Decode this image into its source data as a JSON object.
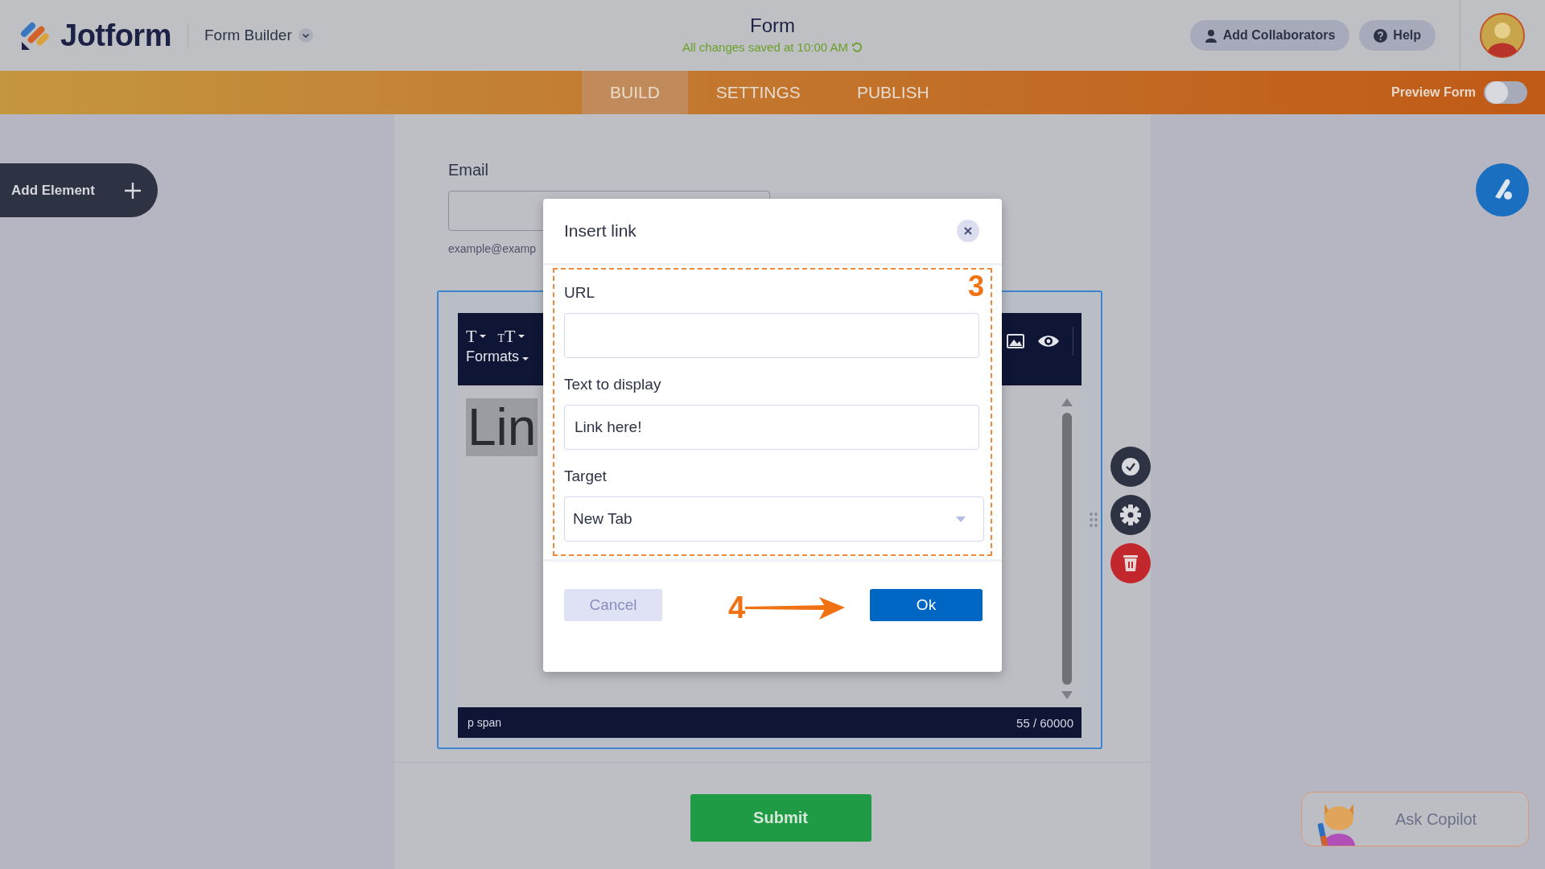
{
  "header": {
    "logo": "Jotform",
    "product_menu": "Form Builder",
    "form_title": "Form",
    "save_status": "All changes saved at 10:00 AM",
    "buttons": [
      {
        "label": "Add Collaborators",
        "kind": "person"
      },
      {
        "label": "Help",
        "kind": "help"
      }
    ]
  },
  "nav": {
    "tabs": [
      {
        "label": "BUILD",
        "selected": true
      },
      {
        "label": "SETTINGS",
        "selected": false
      },
      {
        "label": "PUBLISH",
        "selected": false
      }
    ],
    "preview": {
      "label": "Preview Form",
      "on": false
    }
  },
  "add_element": "Add Element",
  "form": {
    "email": {
      "label": "Email",
      "hint": "example@examp"
    },
    "editor": {
      "tools": [
        "T",
        "TT"
      ],
      "formats": "Formats",
      "content": "Lin",
      "status_path": "p span",
      "char_count": "55 / 60000"
    },
    "submit": "Submit"
  },
  "copilot": "Ask Copilot",
  "dialog": {
    "title": "Insert link",
    "fields": [
      {
        "label": "URL",
        "kind": "text"
      },
      {
        "label": "Text to display",
        "kind": "text",
        "value": "Link here!"
      },
      {
        "label": "Target",
        "kind": "select",
        "value": "New Tab"
      }
    ],
    "buttons": [
      {
        "label": "Cancel",
        "disabled": true
      },
      {
        "label": "Ok",
        "disabled": false
      }
    ]
  },
  "annotations": [
    {
      "label": "3"
    },
    {
      "label": "4"
    }
  ]
}
